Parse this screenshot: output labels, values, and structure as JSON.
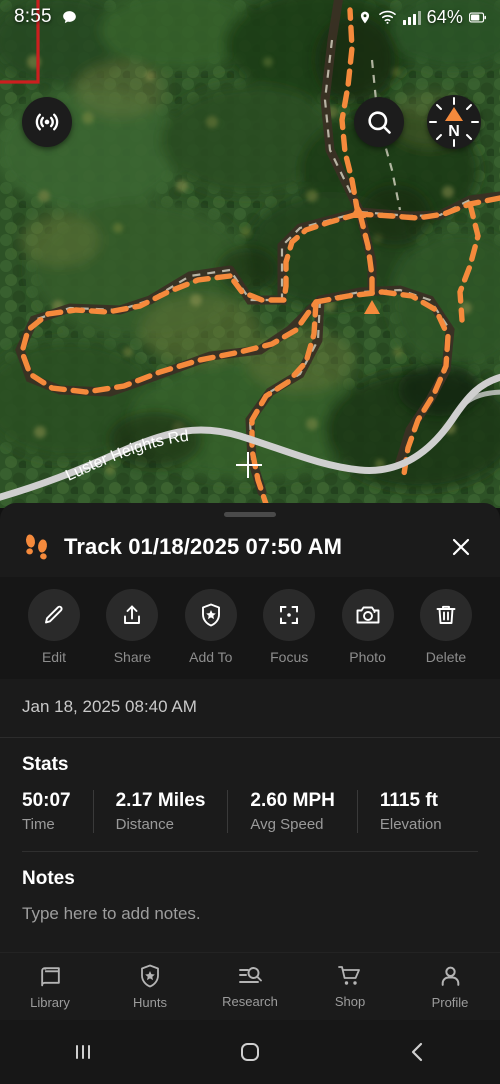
{
  "status_bar": {
    "time": "8:55",
    "message_icon": "chat-bubble-icon",
    "location_icon": "location-pin-icon",
    "wifi_icon": "wifi-icon",
    "signal_icon": "cellular-signal-icon",
    "battery_percent": "64%",
    "battery_icon": "battery-icon"
  },
  "map": {
    "road_label": "Luster Heights Rd",
    "compass_letter": "N",
    "track_color": "#f58a3c",
    "boundary_color": "#cc1f1f",
    "road_color": "#d7d7d7",
    "buttons": {
      "broadcast": "broadcast-icon",
      "search": "search-icon",
      "compass": "compass-icon"
    }
  },
  "sheet": {
    "title": "Track 01/18/2025 07:50 AM",
    "title_icon": "footprints-icon",
    "close_label": "close-icon",
    "date": "Jan 18, 2025 08:40 AM",
    "actions": [
      {
        "label": "Edit",
        "icon": "pencil-icon"
      },
      {
        "label": "Share",
        "icon": "share-upload-icon"
      },
      {
        "label": "Add To",
        "icon": "shield-star-icon"
      },
      {
        "label": "Focus",
        "icon": "focus-crosshair-icon"
      },
      {
        "label": "Photo",
        "icon": "camera-icon"
      },
      {
        "label": "Delete",
        "icon": "trash-icon"
      }
    ],
    "stats_title": "Stats",
    "stats": [
      {
        "value": "50:07",
        "label": "Time"
      },
      {
        "value": "2.17 Miles",
        "label": "Distance"
      },
      {
        "value": "2.60 MPH",
        "label": "Avg Speed"
      },
      {
        "value": "1115 ft",
        "label": "Elevation"
      }
    ],
    "notes_title": "Notes",
    "notes_placeholder": "Type here to add notes."
  },
  "bottom_nav": [
    {
      "label": "Library",
      "icon": "book-icon"
    },
    {
      "label": "Hunts",
      "icon": "shield-star-icon"
    },
    {
      "label": "Research",
      "icon": "search-list-icon"
    },
    {
      "label": "Shop",
      "icon": "cart-icon"
    },
    {
      "label": "Profile",
      "icon": "person-icon"
    }
  ],
  "android_nav": {
    "recents": "recents-icon",
    "home": "home-icon",
    "back": "back-icon"
  }
}
